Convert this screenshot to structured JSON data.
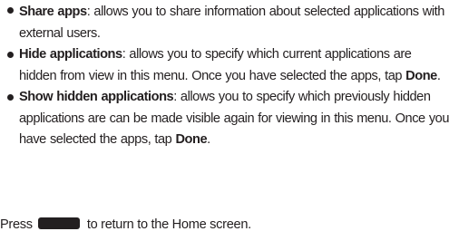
{
  "items": [
    {
      "term": "Share apps",
      "text": ": allows you to share information about selected applications with external users."
    },
    {
      "term": "Hide applications",
      "text": ": allows you to specify which current applications are hidden from view in this menu. Once you have selected the apps, tap ",
      "keyword": "Done",
      "end": "."
    },
    {
      "term": "Show hidden applications",
      "text": ": allows you to specify which previously hidden applications are can be made visible again for viewing in this menu. Once you have selected the apps, tap ",
      "keyword": "Done",
      "end": "."
    }
  ],
  "press_line": {
    "before": "Press",
    "icon": "home-key-icon",
    "after": "to return to the Home screen."
  }
}
